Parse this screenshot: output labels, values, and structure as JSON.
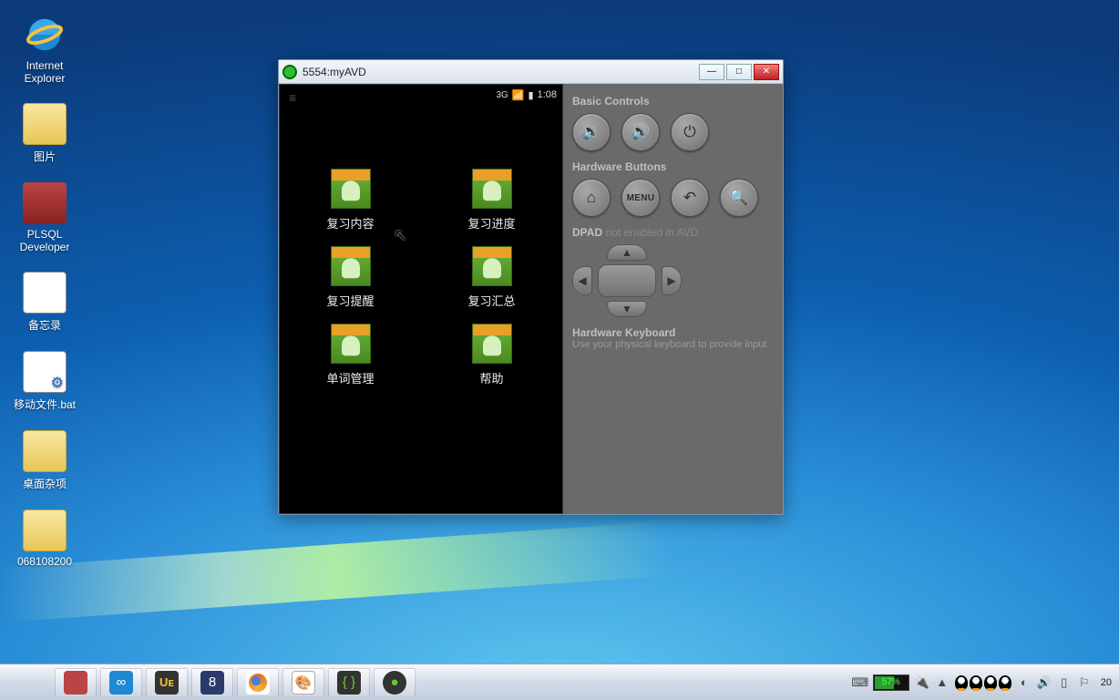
{
  "desktop": {
    "items": [
      {
        "label": "Internet Explorer",
        "icon": "ie"
      },
      {
        "label": "图片",
        "icon": "folder"
      },
      {
        "label": "PLSQL Developer",
        "icon": "plsql"
      },
      {
        "label": "备忘录",
        "icon": "note"
      },
      {
        "label": "移动文件.bat",
        "icon": "bat"
      },
      {
        "label": "桌面杂项",
        "icon": "folder"
      },
      {
        "label": "068108200",
        "icon": "folder"
      }
    ]
  },
  "emulator": {
    "title": "5554:myAVD",
    "status": {
      "network": "3G",
      "time": "1:08"
    },
    "apps": [
      {
        "label": "复习内容"
      },
      {
        "label": "复习进度"
      },
      {
        "label": "复习提醒"
      },
      {
        "label": "复习汇总"
      },
      {
        "label": "单词管理"
      },
      {
        "label": "帮助"
      }
    ],
    "panel": {
      "basic_controls": "Basic Controls",
      "hardware_buttons": "Hardware Buttons",
      "menu_label": "MENU",
      "dpad_label": "DPAD",
      "dpad_disabled": "not enabled in AVD",
      "hk_title": "Hardware Keyboard",
      "hk_sub": "Use your physical keyboard to provide input"
    }
  },
  "taskbar": {
    "battery": "57%",
    "clock_partial": "20"
  }
}
